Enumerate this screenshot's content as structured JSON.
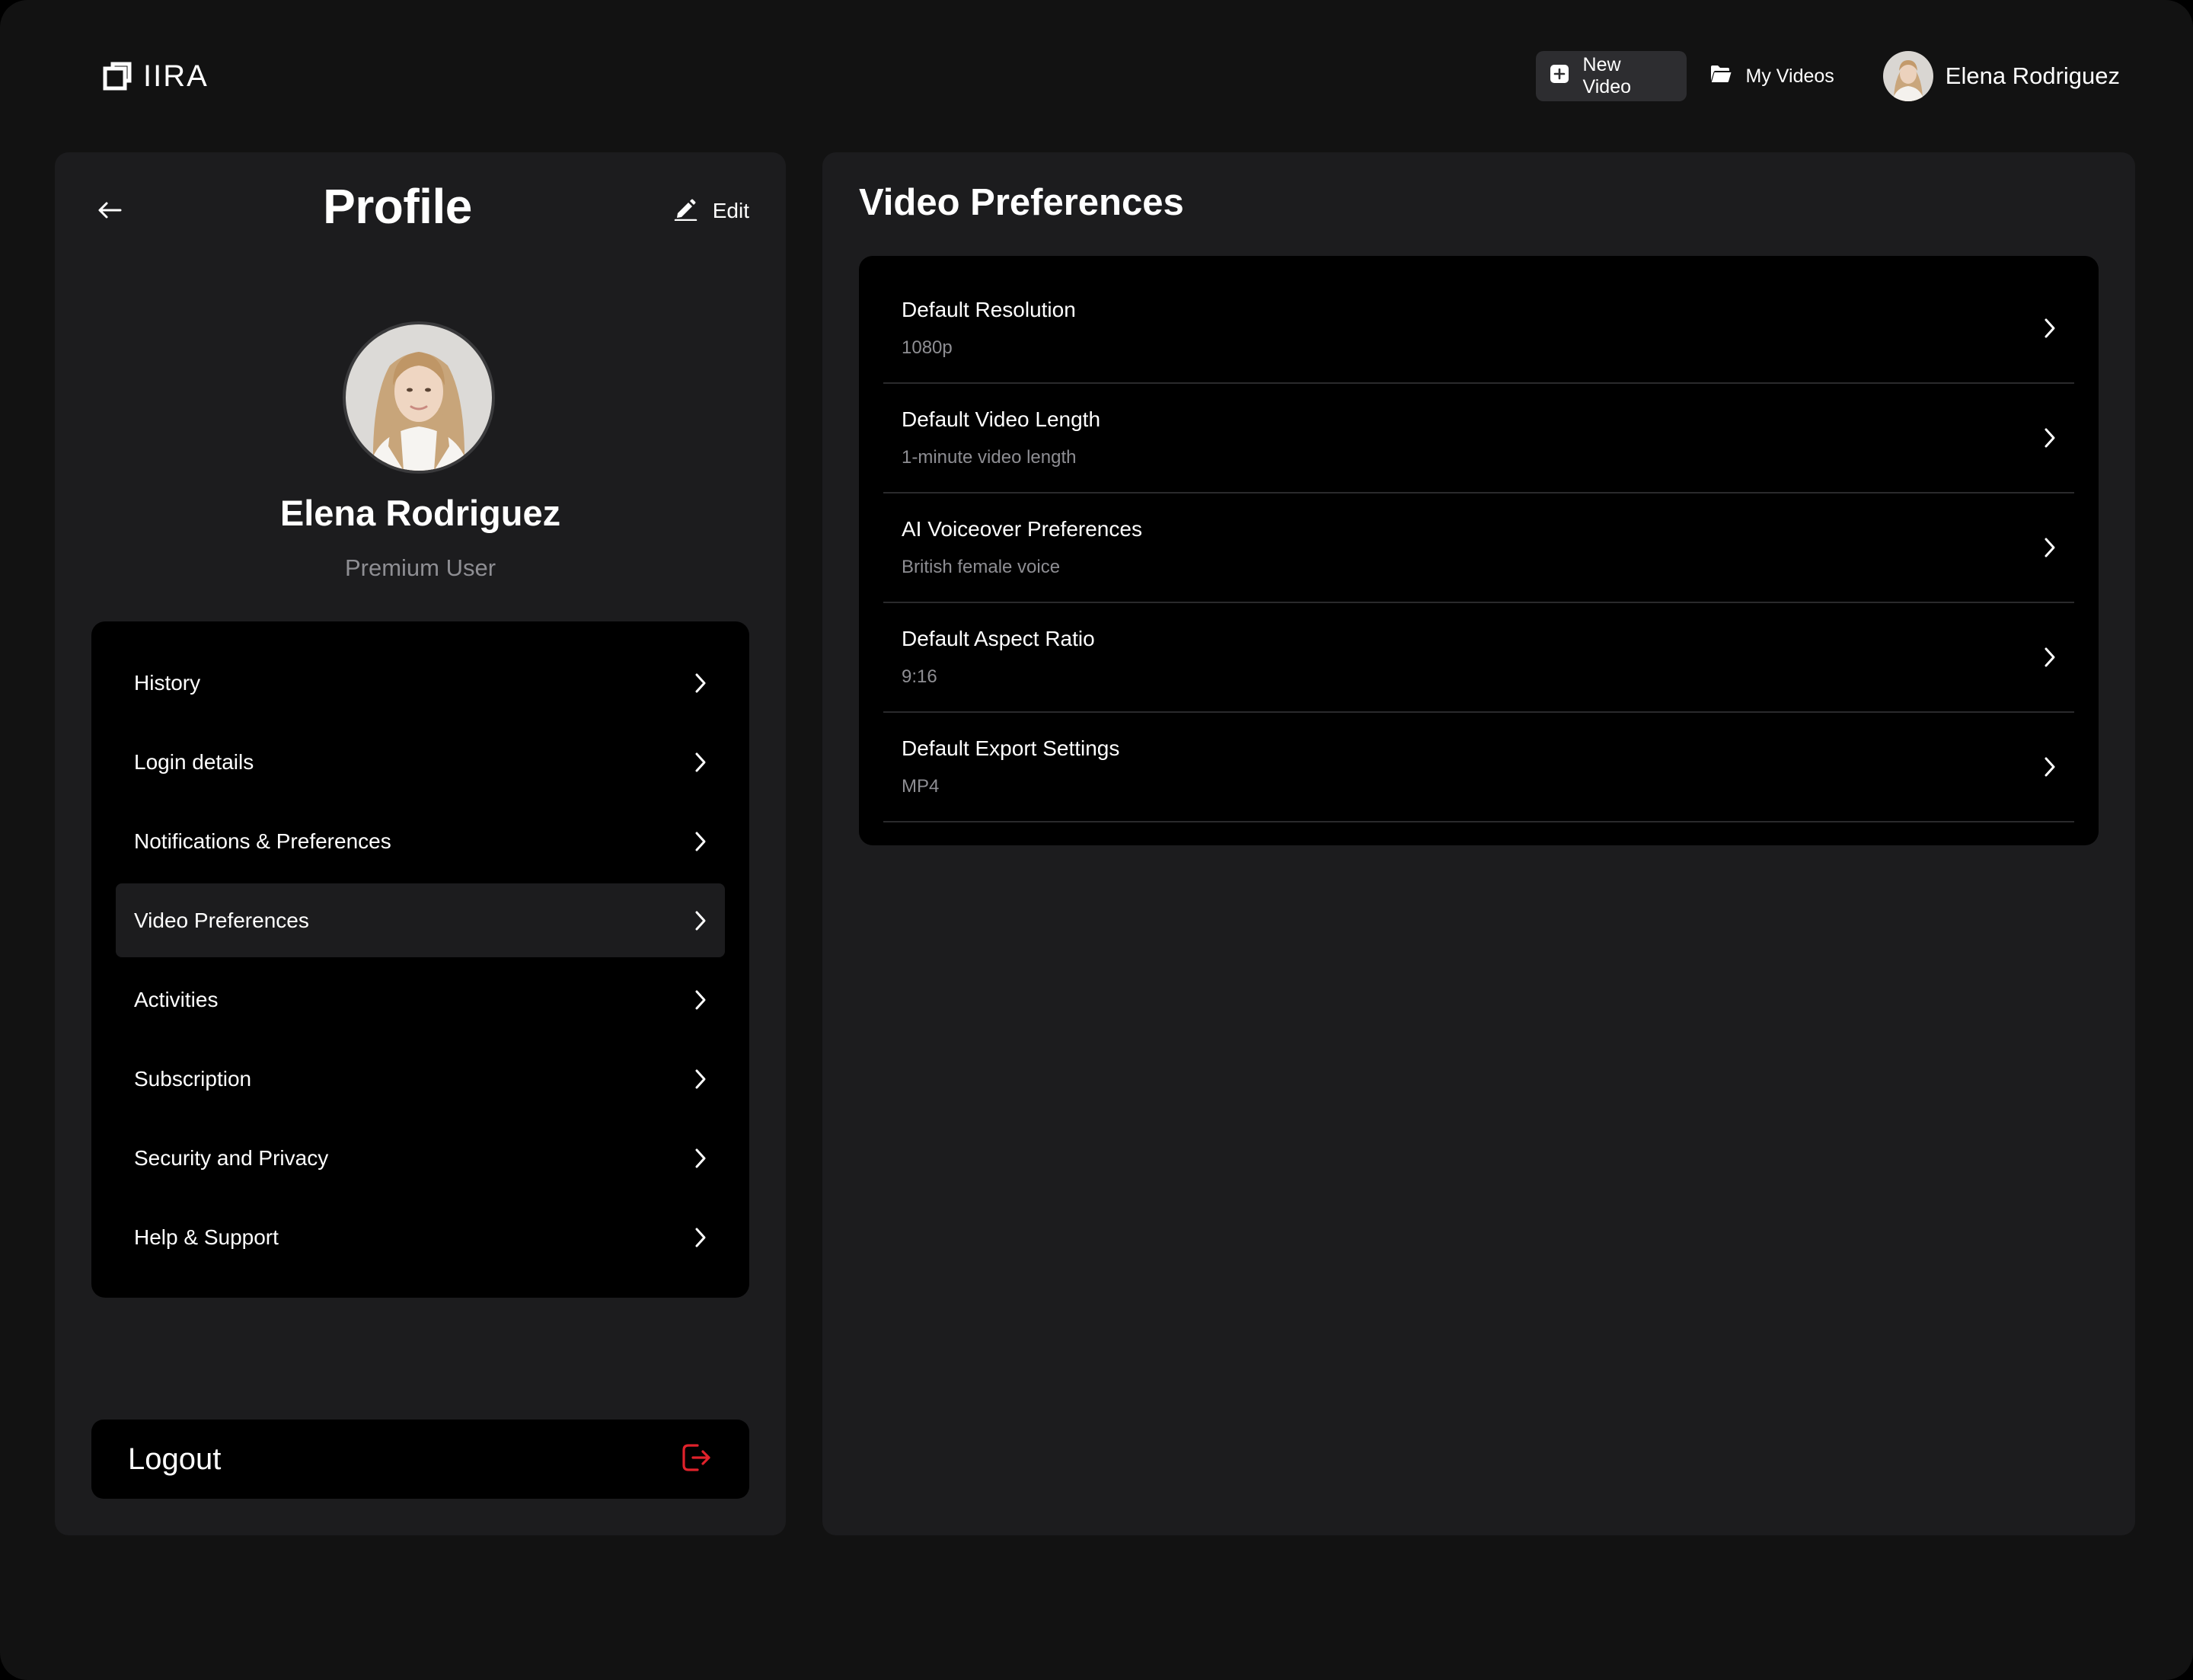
{
  "brand": {
    "name": "IIRA"
  },
  "topnav": {
    "new_video_label": "New Video",
    "my_videos_label": "My Videos",
    "user_name": "Elena Rodriguez"
  },
  "profile": {
    "title": "Profile",
    "edit_label": "Edit",
    "name": "Elena Rodriguez",
    "tier": "Premium User"
  },
  "menu": {
    "items": [
      {
        "label": "History",
        "active": false
      },
      {
        "label": "Login details",
        "active": false
      },
      {
        "label": "Notifications & Preferences",
        "active": false
      },
      {
        "label": "Video Preferences",
        "active": true
      },
      {
        "label": "Activities",
        "active": false
      },
      {
        "label": "Subscription",
        "active": false
      },
      {
        "label": "Security and Privacy",
        "active": false
      },
      {
        "label": "Help & Support",
        "active": false
      }
    ]
  },
  "logout": {
    "label": "Logout"
  },
  "video_preferences": {
    "title": "Video Preferences",
    "rows": [
      {
        "title": "Default Resolution",
        "value": "1080p"
      },
      {
        "title": "Default Video Length",
        "value": "1-minute video length"
      },
      {
        "title": "AI Voiceover Preferences",
        "value": "British female voice"
      },
      {
        "title": "Default Aspect Ratio",
        "value": "9:16"
      },
      {
        "title": "Default Export Settings",
        "value": "MP4"
      }
    ]
  },
  "colors": {
    "background": "#121212",
    "panel": "#1c1c1e",
    "card": "#000000",
    "active_item": "#1c1c1e",
    "muted_text": "#8e8e93",
    "logout_icon": "#e0222b"
  },
  "icons": {
    "logo": "square-bracket-logo-icon",
    "new_video": "plus-square-icon",
    "my_videos": "folder-open-icon",
    "back": "arrow-left-icon",
    "edit": "pencil-icon",
    "chevron": "chevron-right-icon",
    "logout": "logout-icon"
  }
}
